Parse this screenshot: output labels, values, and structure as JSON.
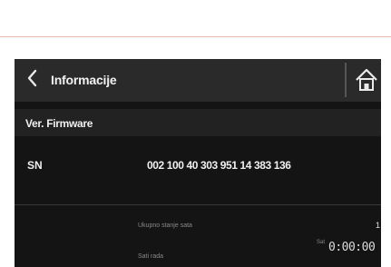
{
  "screen": {
    "title": "Informacije",
    "section_header": "Ver. Firmware"
  },
  "icons": {
    "back": "chevron-left-icon",
    "home": "home-icon"
  },
  "rows": [
    {
      "label": "SN",
      "value": "002 100 40 303 951 14 383 136"
    }
  ],
  "footer": {
    "line1_label": "Ukupno stanje sata",
    "line1_value": "1",
    "line2_label": "Sati rada",
    "time_caption": "Sat",
    "time_value": "0:00:00"
  },
  "colors": {
    "background": "#141414",
    "titlebar": "#2a2a2a",
    "text": "#f0f0f0",
    "muted": "#8a8a8a"
  }
}
